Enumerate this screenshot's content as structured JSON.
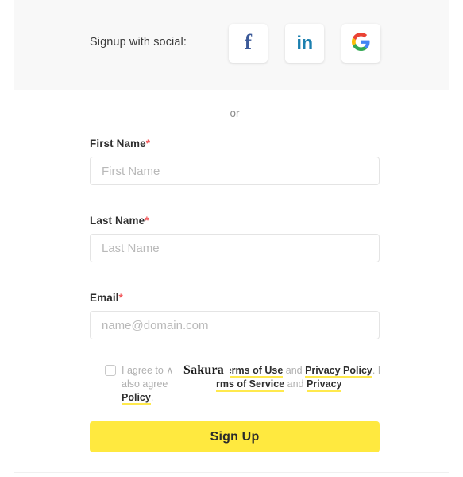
{
  "social": {
    "label": "Signup with social:",
    "buttons": [
      {
        "name": "facebook",
        "glyph": "f"
      },
      {
        "name": "linkedin",
        "glyph": "in"
      },
      {
        "name": "google",
        "glyph": "G"
      }
    ]
  },
  "divider": {
    "text": "or"
  },
  "form": {
    "first_name": {
      "label": "First Name",
      "required_mark": "*",
      "placeholder": "First Name",
      "value": ""
    },
    "last_name": {
      "label": "Last Name",
      "required_mark": "*",
      "placeholder": "Last Name",
      "value": ""
    },
    "email": {
      "label": "Email",
      "required_mark": "*",
      "placeholder": "name@domain.com",
      "value": ""
    }
  },
  "consent": {
    "checked": false,
    "base_line1": "I agree to ",
    "base_line1_clipped": "∧",
    "base_line2": "also agree",
    "base_link": "Policy",
    "base_period": ".",
    "overlay_line1_link1": "Terms of Use",
    "overlay_line1_and": " and ",
    "overlay_line1_link2": "Privacy Policy",
    "overlay_line1_tail": ". I",
    "overlay_line2_link1": "rms of Service",
    "overlay_line2_and": " and ",
    "overlay_line2_link2": "Privacy",
    "brand_overlay": "Sakura"
  },
  "submit": {
    "label": "Sign Up"
  },
  "colors": {
    "accent_yellow": "#ffe93f",
    "highlight_underline": "#ffe94d",
    "required_red": "#f2585b",
    "facebook_blue": "#3b5998",
    "linkedin_blue": "#1b7faf",
    "band_gray": "#f8f8f8"
  }
}
